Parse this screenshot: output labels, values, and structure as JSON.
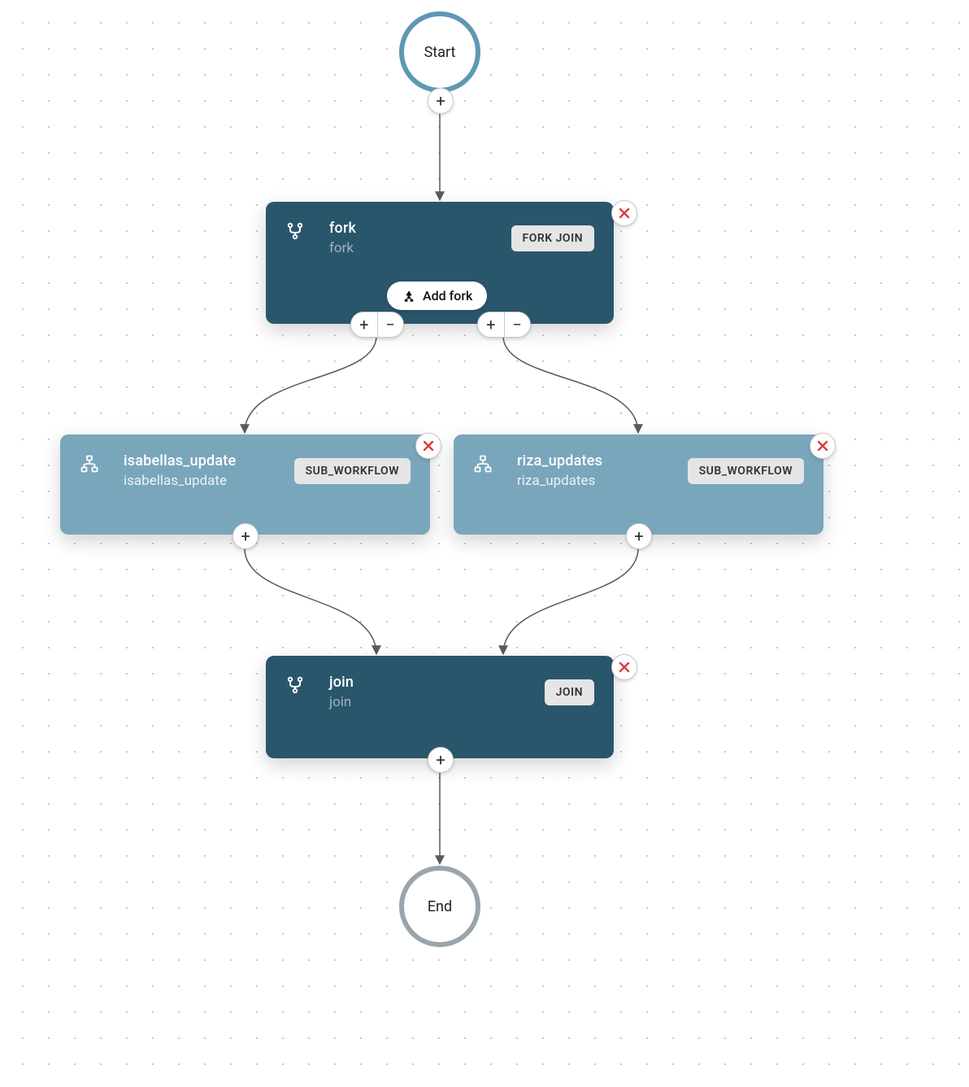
{
  "terminals": {
    "start": "Start",
    "end": "End"
  },
  "fork": {
    "title": "fork",
    "subtitle": "fork",
    "badge": "FORK JOIN",
    "add_fork_label": "Add fork"
  },
  "join": {
    "title": "join",
    "subtitle": "join",
    "badge": "JOIN"
  },
  "branches": [
    {
      "title": "isabellas_update",
      "subtitle": "isabellas_update",
      "badge": "SUB_WORKFLOW"
    },
    {
      "title": "riza_updates",
      "subtitle": "riza_updates",
      "badge": "SUB_WORKFLOW"
    }
  ],
  "glyphs": {
    "plus": "+",
    "minus": "−"
  }
}
